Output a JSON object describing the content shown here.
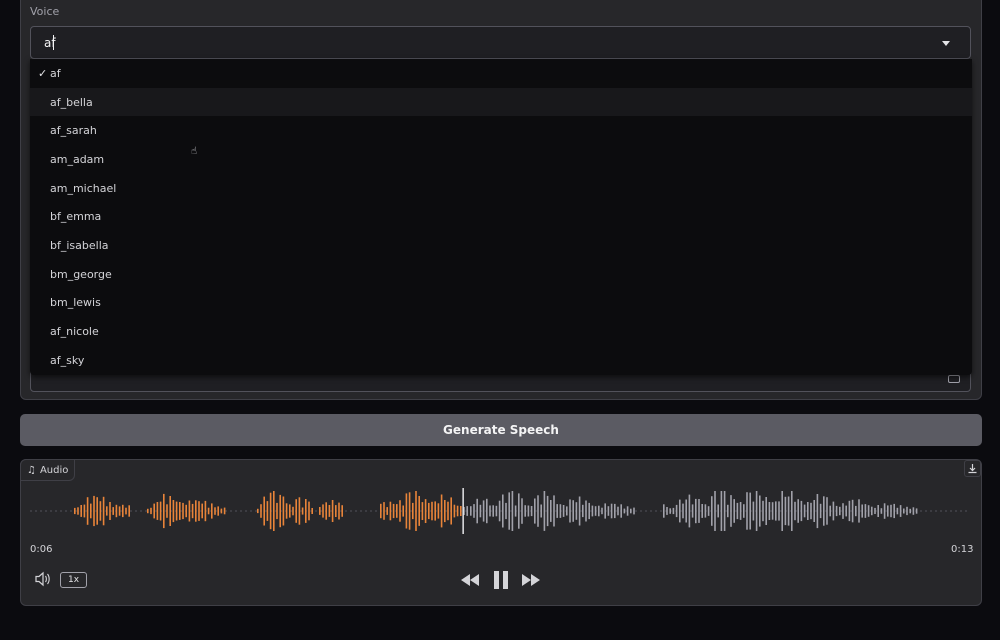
{
  "voice": {
    "label": "Voice",
    "value": "af",
    "options": [
      "af",
      "af_bella",
      "af_sarah",
      "am_adam",
      "am_michael",
      "bf_emma",
      "bf_isabella",
      "bm_george",
      "bm_lewis",
      "af_nicole",
      "af_sky"
    ],
    "selected": "af",
    "hovered": "af_bella"
  },
  "generate_button": {
    "label": "Generate Speech"
  },
  "audio": {
    "tag_label": "Audio",
    "current_time": "0:06",
    "duration": "0:13",
    "playback_rate": "1x",
    "progress": 0.46,
    "played_color": "#e8843a",
    "unplayed_color": "#a1a1aa"
  },
  "icons": {
    "check": "check-icon",
    "dropdown": "chevron-down-icon",
    "music": "music-note-icon",
    "download": "download-icon",
    "volume": "volume-icon",
    "rewind": "rewind-icon",
    "pause": "pause-icon",
    "forward": "fast-forward-icon"
  }
}
